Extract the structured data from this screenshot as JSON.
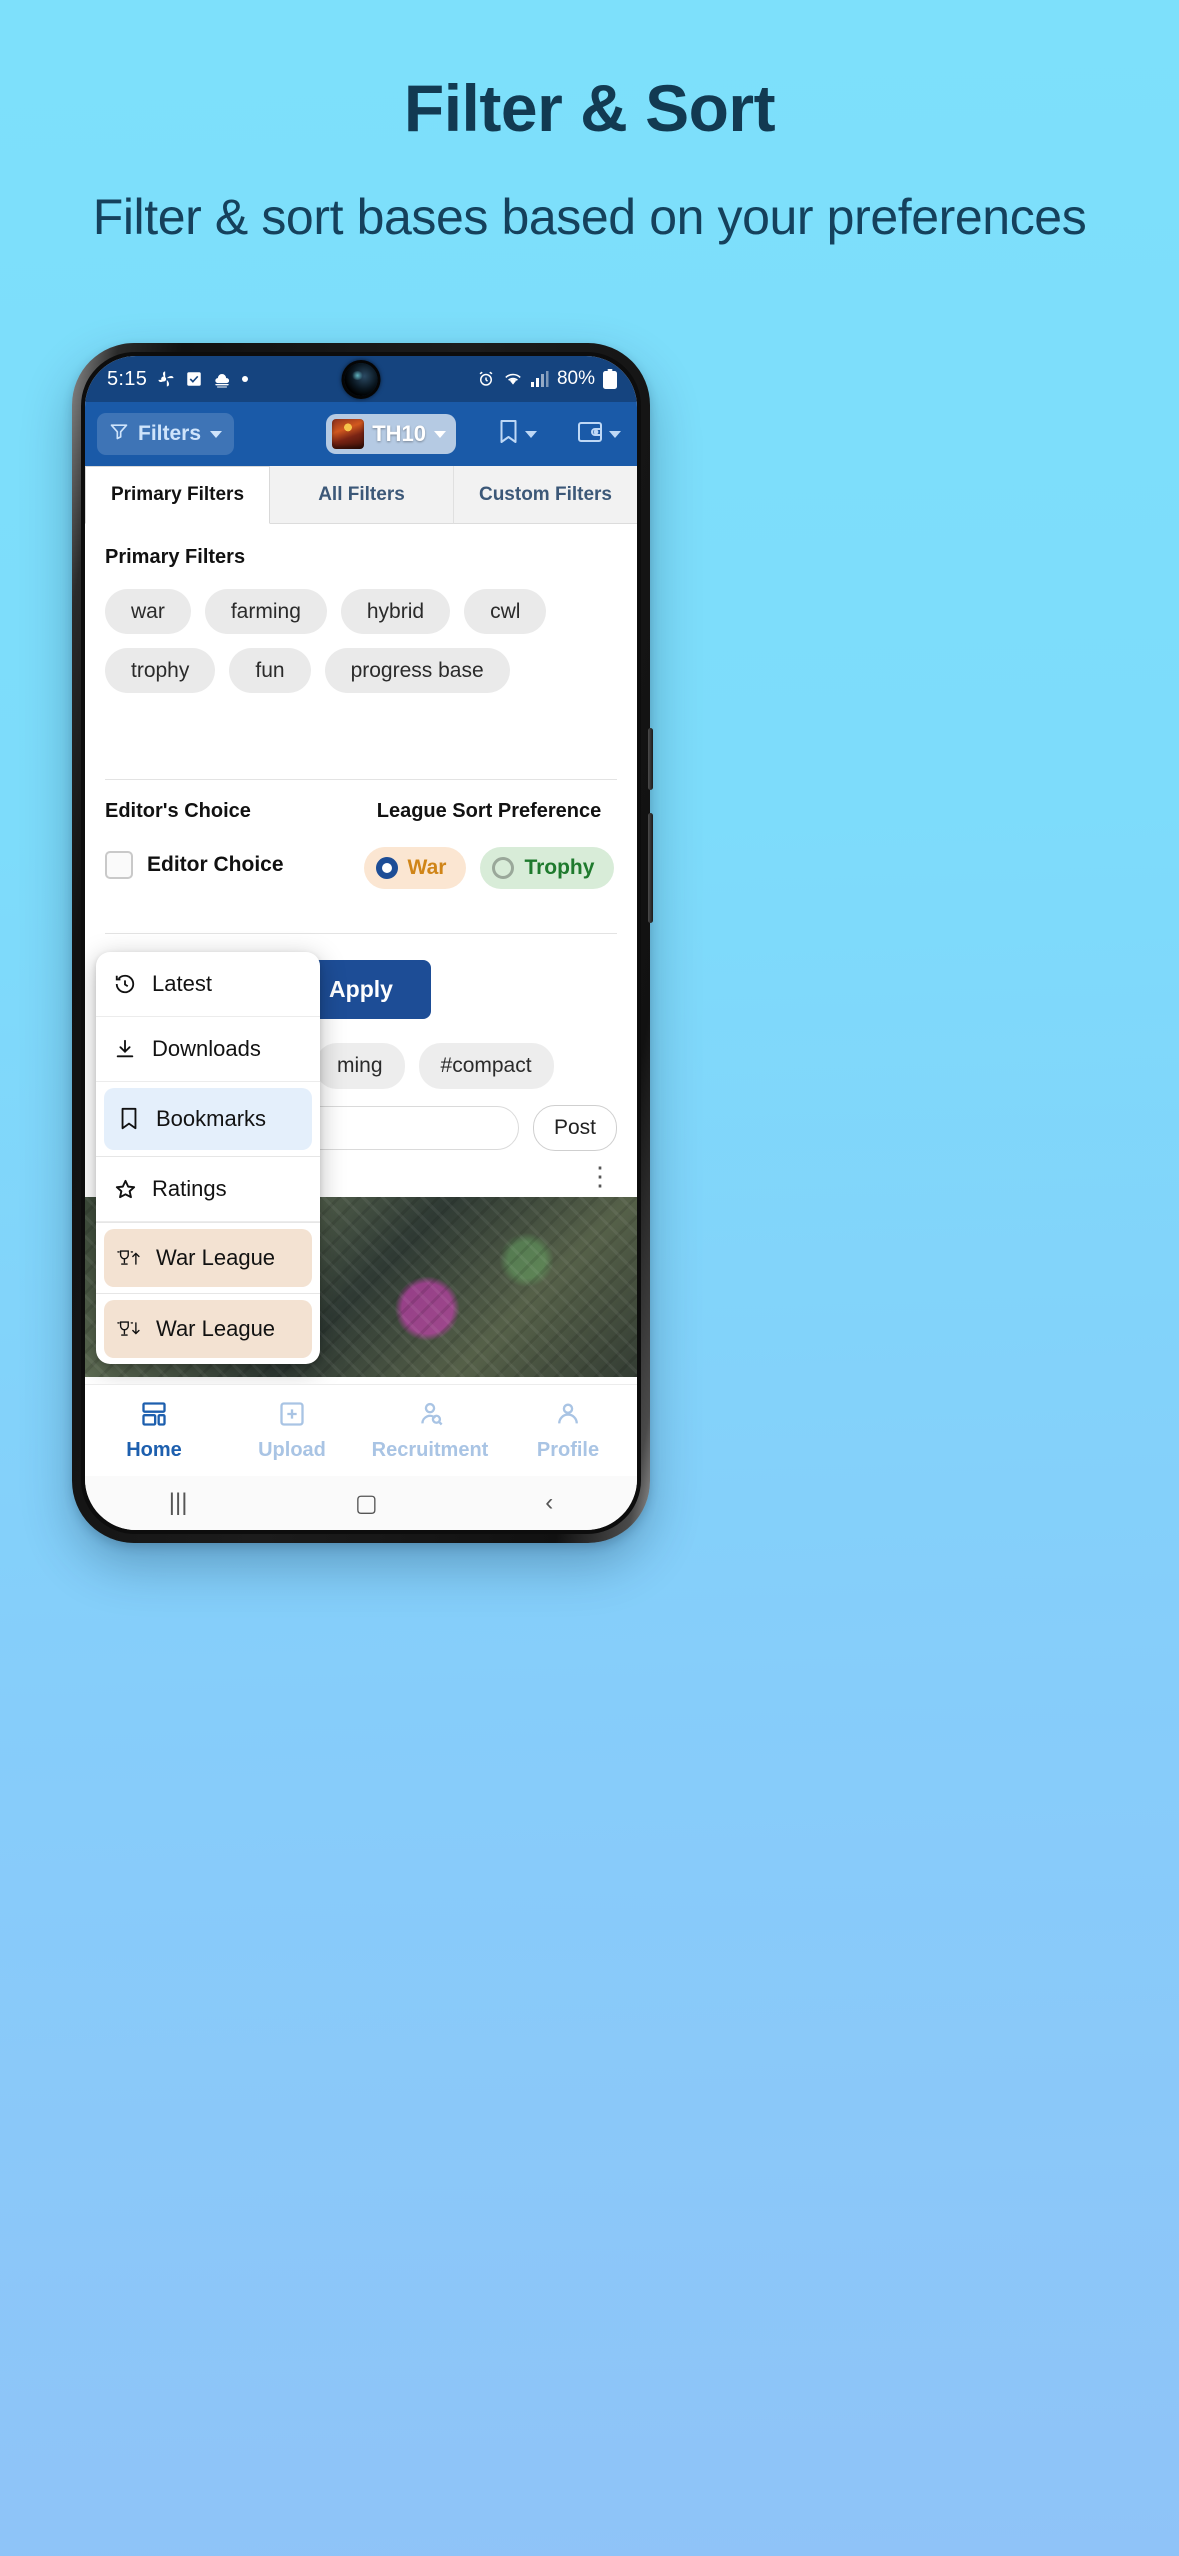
{
  "promo": {
    "title": "Filter & Sort",
    "subtitle": "Filter & sort bases based on your preferences"
  },
  "status_bar": {
    "time": "5:15",
    "battery": "80%",
    "icons_left": [
      "pinwheel-icon",
      "checkbox-icon",
      "cloud-icon",
      "dot-icon"
    ],
    "icons_right": [
      "alarm-icon",
      "wifi-icon",
      "signal-icon",
      "battery-icon"
    ]
  },
  "appbar": {
    "filters_label": "Filters",
    "townhall_label": "TH10",
    "bookmark_icon": "bookmark-icon",
    "wallet_icon": "wallet-icon"
  },
  "tabs": [
    {
      "label": "Primary Filters",
      "active": true
    },
    {
      "label": "All Filters",
      "active": false
    },
    {
      "label": "Custom Filters",
      "active": false
    }
  ],
  "primary_filters": {
    "heading": "Primary Filters",
    "chips": [
      "war",
      "farming",
      "hybrid",
      "cwl",
      "trophy",
      "fun",
      "progress base"
    ]
  },
  "editors_choice": {
    "heading": "Editor's Choice",
    "checkbox_label": "Editor Choice",
    "checked": false
  },
  "league_sort": {
    "heading": "League Sort Preference",
    "options": [
      {
        "label": "War",
        "selected": true,
        "color": "#d08518"
      },
      {
        "label": "Trophy",
        "selected": false,
        "color": "#1f7a2e"
      }
    ]
  },
  "apply_button": {
    "label": "Apply",
    "color": "#1d4d96"
  },
  "feed": {
    "tags": [
      "ming",
      "#compact"
    ],
    "post_button": "Post",
    "comment_placeholder": "",
    "kebab_icon": "more-vertical-icon"
  },
  "dropdown": {
    "items": [
      {
        "label": "Latest",
        "icon": "history-clock-icon",
        "state": "normal"
      },
      {
        "label": "Downloads",
        "icon": "download-icon",
        "state": "normal"
      },
      {
        "label": "Bookmarks",
        "icon": "bookmark-icon",
        "state": "selected"
      },
      {
        "label": "Ratings",
        "icon": "star-icon",
        "state": "normal"
      },
      {
        "label": "War League",
        "icon": "trophy-up-icon",
        "state": "warleague"
      },
      {
        "label": "War League",
        "icon": "trophy-down-icon",
        "state": "warleague"
      }
    ]
  },
  "bottom_nav": [
    {
      "label": "Home",
      "icon": "dashboard-icon",
      "active": true
    },
    {
      "label": "Upload",
      "icon": "plus-square-icon",
      "active": false
    },
    {
      "label": "Recruitment",
      "icon": "person-search-icon",
      "active": false
    },
    {
      "label": "Profile",
      "icon": "person-icon",
      "active": false
    }
  ],
  "system_nav": [
    "recents-icon",
    "home-icon",
    "back-icon"
  ]
}
